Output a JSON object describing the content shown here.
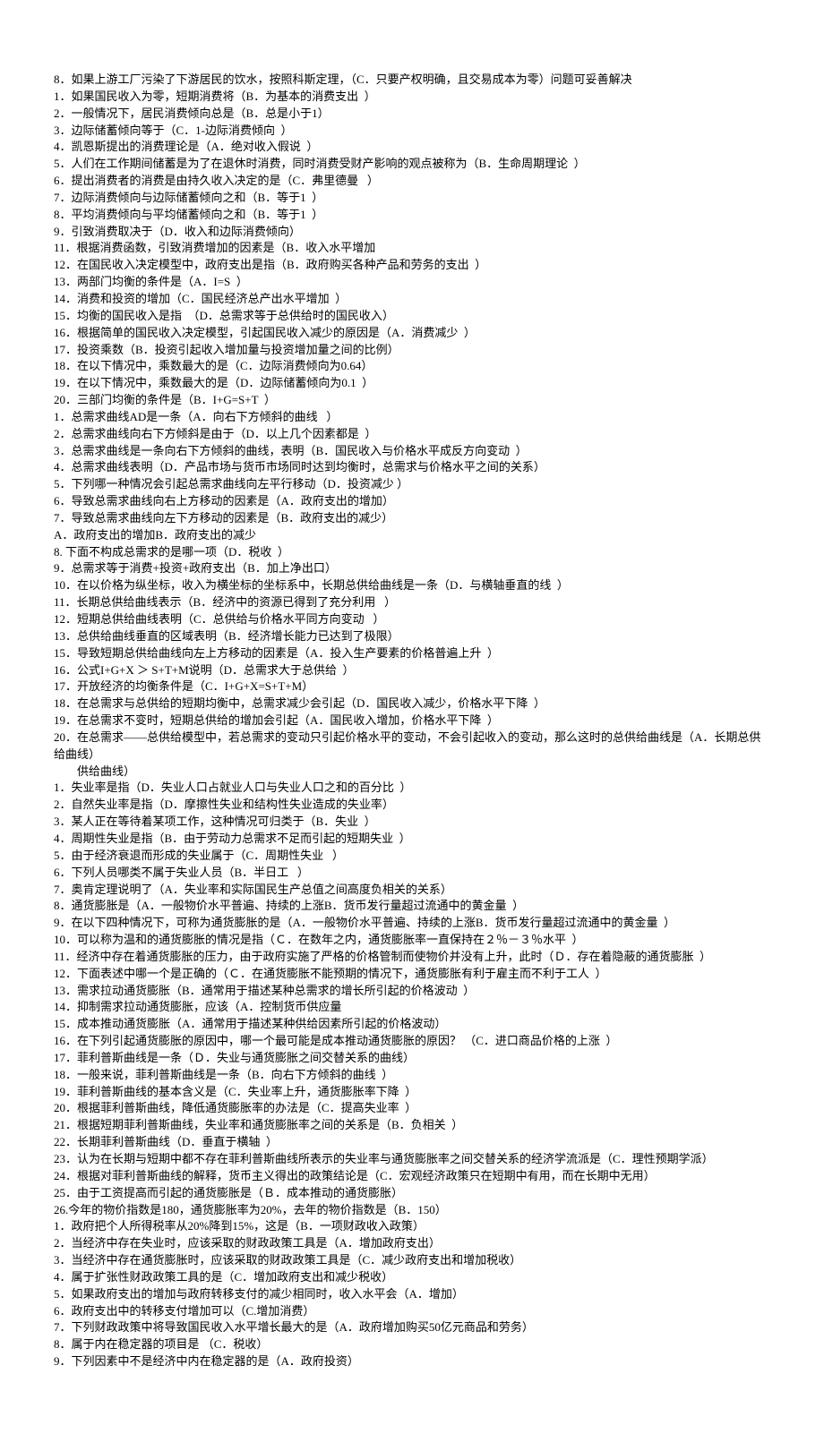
{
  "lines": [
    {
      "text": "8．如果上游工厂污染了下游居民的饮水，按照科斯定理，（C．只要产权明确，且交易成本为零）问题可妥善解决"
    },
    {
      "text": "1．如果国民收入为零，短期消费将（B．为基本的消费支出  ）"
    },
    {
      "text": "2．一般情况下，居民消费倾向总是（B．总是小于1）"
    },
    {
      "text": "3．边际储蓄倾向等于（C．1-边际消费倾向  ）"
    },
    {
      "text": "4．凯恩斯提出的消费理论是（A．绝对收入假说  ）"
    },
    {
      "text": "5．人们在工作期间储蓄是为了在退休时消费，同时消费受财产影响的观点被称为（B．生命周期理论  ）"
    },
    {
      "text": "6．提出消费者的消费是由持久收入决定的是（C．弗里德曼   ）"
    },
    {
      "text": "7．边际消费倾向与边际储蓄倾向之和（B．等于1  ）"
    },
    {
      "text": "8．平均消费倾向与平均储蓄倾向之和（B．等于1  ）"
    },
    {
      "text": "9．引致消费取决于（D．收入和边际消费倾向）"
    },
    {
      "text": "11．根据消费函数，引致消费增加的因素是（B．收入水平增加"
    },
    {
      "text": "12．在国民收入决定模型中，政府支出是指（B．政府购买各种产品和劳务的支出  ）"
    },
    {
      "text": "13．两部门均衡的条件是（A．I=S  ）"
    },
    {
      "text": "14．消费和投资的增加（C．国民经济总产出水平增加  ）"
    },
    {
      "text": "15．均衡的国民收入是指  （D．总需求等于总供给时的国民收入）"
    },
    {
      "text": "16．根据简单的国民收入决定模型，引起国民收入减少的原因是（A．消费减少  ）"
    },
    {
      "text": "17．投资乘数（B．投资引起收入增加量与投资增加量之间的比例）"
    },
    {
      "text": "18．在以下情况中，乘数最大的是（C．边际消费倾向为0.64）"
    },
    {
      "text": "19．在以下情况中，乘数最大的是（D．边际储蓄倾向为0.1  ）"
    },
    {
      "text": "20．三部门均衡的条件是（B．I+G=S+T  ）"
    },
    {
      "text": "1．总需求曲线AD是一条（A．向右下方倾斜的曲线   ）"
    },
    {
      "text": "2．总需求曲线向右下方倾斜是由于（D．以上几个因素都是  ）"
    },
    {
      "text": "3．总需求曲线是一条向右下方倾斜的曲线，表明（B．国民收入与价格水平成反方向变动  ）"
    },
    {
      "text": "4．总需求曲线表明（D．产品市场与货币市场同时达到均衡时，总需求与价格水平之间的关系）"
    },
    {
      "text": "5．下列哪一种情况会引起总需求曲线向左平行移动（D．投资减少 ）"
    },
    {
      "text": "6．导致总需求曲线向右上方移动的因素是（A．政府支出的增加）"
    },
    {
      "text": "7．导致总需求曲线向左下方移动的因素是（B．政府支出的减少）"
    },
    {
      "text": "A．政府支出的增加B．政府支出的减少"
    },
    {
      "text": "8. 下面不构成总需求的是哪一项（D．税收  ）"
    },
    {
      "text": "9．总需求等于消费+投资+政府支出（B．加上净出口）"
    },
    {
      "text": "10．在以价格为纵坐标，收入为横坐标的坐标系中，长期总供给曲线是一条（D．与横轴垂直的线  ）"
    },
    {
      "text": "11．长期总供给曲线表示（B．经济中的资源已得到了充分利用   ）"
    },
    {
      "text": "12．短期总供给曲线表明（C．总供给与价格水平同方向变动   ）"
    },
    {
      "text": "13．总供给曲线垂直的区域表明（B．经济增长能力已达到了极限）"
    },
    {
      "text": "15．导致短期总供给曲线向左上方移动的因素是（A．投入生产要素的价格普遍上升  ）"
    },
    {
      "text": "16．公式I+G+X ＞ S+T+M说明（D．总需求大于总供给  ）"
    },
    {
      "text": "17．开放经济的均衡条件是（C．I+G+X=S+T+M）"
    },
    {
      "text": "18．在总需求与总供给的短期均衡中，总需求减少会引起（D．国民收入减少，价格水平下降  ）"
    },
    {
      "text": "19．在总需求不变时，短期总供给的增加会引起（A．国民收入增加，价格水平下降  ）"
    },
    {
      "text": "20．在总需求——总供给模型中，若总需求的变动只引起价格水平的变动，不会引起收入的变动，那么这时的总供给曲线是（A．长期总供给曲线）",
      "indent": true
    },
    {
      "text": "1．失业率是指（D．失业人口占就业人口与失业人口之和的百分比  ）"
    },
    {
      "text": "2．自然失业率是指（D．摩擦性失业和结构性失业造成的失业率）"
    },
    {
      "text": "3．某人正在等待着某项工作，这种情况可归类于（B．失业  ）"
    },
    {
      "text": "4．周期性失业是指（B．由于劳动力总需求不足而引起的短期失业  ）"
    },
    {
      "text": "5．由于经济衰退而形成的失业属于（C．周期性失业   ）"
    },
    {
      "text": "6．下列人员哪类不属于失业人员（B．半日工   ）"
    },
    {
      "text": "7．奥肯定理说明了（A．失业率和实际国民生产总值之间高度负相关的关系）"
    },
    {
      "text": "8．通货膨胀是（A．一般物价水平普遍、持续的上涨B．货币发行量超过流通中的黄金量  ）"
    },
    {
      "text": "9．在以下四种情况下，可称为通货膨胀的是（A．一般物价水平普遍、持续的上涨B．货币发行量超过流通中的黄金量  ）"
    },
    {
      "text": "10．可以称为温和的通货膨胀的情况是指（Ｃ．在数年之内，通货膨胀率一直保持在２％－３％水平  ）"
    },
    {
      "text": "11．经济中存在着通货膨胀的压力，由于政府实施了严格的价格管制而使物价并没有上升，此时（Ｄ．存在着隐蔽的通货膨胀  ）"
    },
    {
      "text": "12．下面表述中哪一个是正确的（Ｃ．在通货膨胀不能预期的情况下，通货膨胀有利于雇主而不利于工人  ）"
    },
    {
      "text": "13．需求拉动通货膨胀（B．通常用于描述某种总需求的增长所引起的价格波动  ）"
    },
    {
      "text": "14．抑制需求拉动通货膨胀，应该（A．控制货币供应量"
    },
    {
      "text": "15．成本推动通货膨胀（A．通常用于描述某种供给因素所引起的价格波动）"
    },
    {
      "text": "16．在下列引起通货膨胀的原因中，哪一个最可能是成本推动通货膨胀的原因？ （C．进口商品价格的上涨  ）"
    },
    {
      "text": "17．菲利普斯曲线是一条（Ｄ．失业与通货膨胀之间交替关系的曲线）"
    },
    {
      "text": "18．一般来说，菲利普斯曲线是一条（B．向右下方倾斜的曲线  ）"
    },
    {
      "text": "19．菲利普斯曲线的基本含义是（C．失业率上升，通货膨胀率下降  ）"
    },
    {
      "text": "20．根据菲利普斯曲线，降低通货膨胀率的办法是（C．提高失业率  ）"
    },
    {
      "text": "21．根据短期菲利普斯曲线，失业率和通货膨胀率之间的关系是（B．负相关  ）"
    },
    {
      "text": "22．长期菲利普斯曲线（D．垂直于横轴  ）"
    },
    {
      "text": "23．认为在长期与短期中都不存在菲利普斯曲线所表示的失业率与通货膨胀率之间交替关系的经济学流派是（C．理性预期学派）"
    },
    {
      "text": "24．根据对菲利普斯曲线的解释，货币主义得出的政策结论是（C．宏观经济政策只在短期中有用，而在长期中无用）"
    },
    {
      "text": "25．由于工资提高而引起的通货膨胀是（Ｂ．成本推动的通货膨胀）"
    },
    {
      "text": "26.今年的物价指数是180，通货膨胀率为20%，去年的物价指数是（B．150）"
    },
    {
      "text": "1．政府把个人所得税率从20%降到15%，这是（B．一项财政收入政策）"
    },
    {
      "text": "2．当经济中存在失业时，应该采取的财政政策工具是（A．增加政府支出）"
    },
    {
      "text": "3．当经济中存在通货膨胀时，应该采取的财政政策工具是（C．减少政府支出和增加税收）"
    },
    {
      "text": "4．属于扩张性财政政策工具的是（C．增加政府支出和减少税收）"
    },
    {
      "text": "5．如果政府支出的增加与政府转移支付的减少相同时，收入水平会（A．增加）"
    },
    {
      "text": "6．政府支出中的转移支付增加可以（C.增加消费）"
    },
    {
      "text": "7．下列财政政策中将导致国民收入水平增长最大的是（A．政府增加购买50亿元商品和劳务）"
    },
    {
      "text": "8．属于内在稳定器的项目是 （C．税收）"
    },
    {
      "text": "9．下列因素中不是经济中内在稳定器的是（A．政府投资）"
    }
  ]
}
